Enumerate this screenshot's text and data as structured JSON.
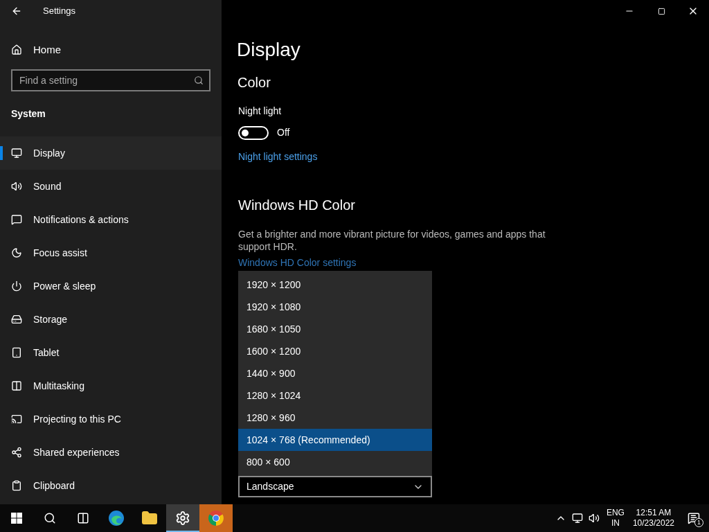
{
  "window": {
    "title": "Settings"
  },
  "sidebar": {
    "home": "Home",
    "search": {
      "placeholder": "Find a setting"
    },
    "section": "System",
    "items": [
      {
        "label": "Display",
        "selected": true
      },
      {
        "label": "Sound",
        "selected": false
      },
      {
        "label": "Notifications & actions",
        "selected": false
      },
      {
        "label": "Focus assist",
        "selected": false
      },
      {
        "label": "Power & sleep",
        "selected": false
      },
      {
        "label": "Storage",
        "selected": false
      },
      {
        "label": "Tablet",
        "selected": false
      },
      {
        "label": "Multitasking",
        "selected": false
      },
      {
        "label": "Projecting to this PC",
        "selected": false
      },
      {
        "label": "Shared experiences",
        "selected": false
      },
      {
        "label": "Clipboard",
        "selected": false
      }
    ]
  },
  "content": {
    "title": "Display",
    "section": "Color",
    "night_light": {
      "label": "Night light",
      "on": false,
      "state_text": "Off",
      "link": "Night light settings"
    },
    "hd_color": {
      "title": "Windows HD Color",
      "description": "Get a brighter and more vibrant picture for videos, games and apps that support HDR.",
      "link": "Windows HD Color settings"
    },
    "resolution_menu": [
      {
        "label": "1920 × 1200",
        "selected": false
      },
      {
        "label": "1920 × 1080",
        "selected": false
      },
      {
        "label": "1680 × 1050",
        "selected": false
      },
      {
        "label": "1600 × 1200",
        "selected": false
      },
      {
        "label": "1440 × 900",
        "selected": false
      },
      {
        "label": "1280 × 1024",
        "selected": false
      },
      {
        "label": "1280 × 960",
        "selected": false
      },
      {
        "label": "1024 × 768 (Recommended)",
        "selected": true
      },
      {
        "label": "800 × 600",
        "selected": false
      }
    ],
    "orientation": {
      "value": "Landscape"
    }
  },
  "taskbar": {
    "apps": [
      {
        "selected": false,
        "attention": false
      },
      {
        "selected": false,
        "attention": false
      },
      {
        "selected": true,
        "attention": false
      },
      {
        "selected": false,
        "attention": true
      }
    ],
    "language": "ENG",
    "region": "IN",
    "time": "12:51 AM",
    "date": "10/23/2022",
    "notifications": "1"
  }
}
